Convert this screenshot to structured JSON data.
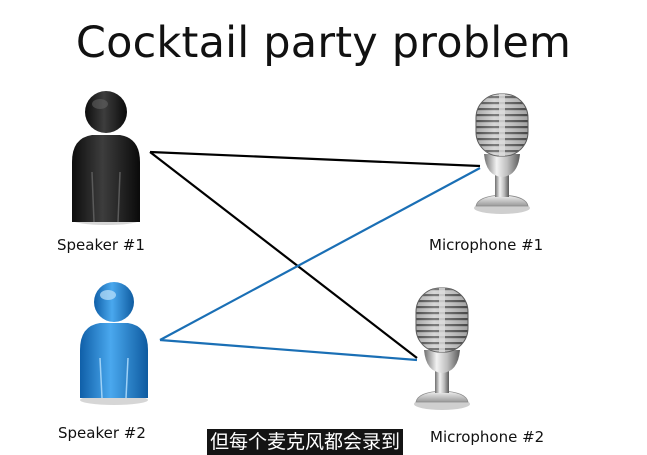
{
  "slide": {
    "title": "Cocktail party problem"
  },
  "speakers": [
    {
      "label": "Speaker #1",
      "color": "#1a1a1a"
    },
    {
      "label": "Speaker #2",
      "color": "#1f86d6"
    }
  ],
  "microphones": [
    {
      "label": "Microphone #1"
    },
    {
      "label": "Microphone #2"
    }
  ],
  "connections": [
    {
      "from": "Speaker #1",
      "to": "Microphone #1",
      "color": "#000000"
    },
    {
      "from": "Speaker #1",
      "to": "Microphone #2",
      "color": "#000000"
    },
    {
      "from": "Speaker #2",
      "to": "Microphone #1",
      "color": "#1a6fb5"
    },
    {
      "from": "Speaker #2",
      "to": "Microphone #2",
      "color": "#1a6fb5"
    }
  ],
  "subtitle_text": "但每个麦克风都会录到"
}
